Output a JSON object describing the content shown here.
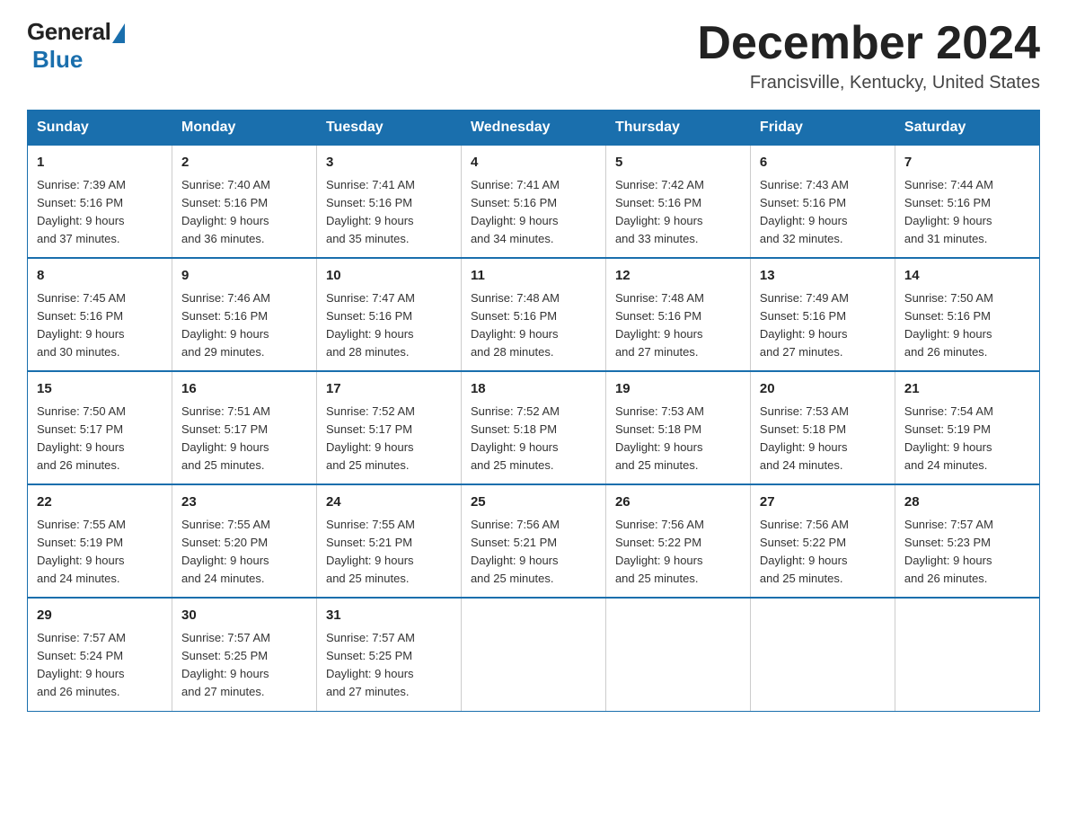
{
  "header": {
    "logo": {
      "general": "General",
      "blue": "Blue"
    },
    "title": "December 2024",
    "location": "Francisville, Kentucky, United States"
  },
  "days_of_week": [
    "Sunday",
    "Monday",
    "Tuesday",
    "Wednesday",
    "Thursday",
    "Friday",
    "Saturday"
  ],
  "weeks": [
    [
      {
        "day": "1",
        "sunrise": "7:39 AM",
        "sunset": "5:16 PM",
        "daylight": "9 hours and 37 minutes."
      },
      {
        "day": "2",
        "sunrise": "7:40 AM",
        "sunset": "5:16 PM",
        "daylight": "9 hours and 36 minutes."
      },
      {
        "day": "3",
        "sunrise": "7:41 AM",
        "sunset": "5:16 PM",
        "daylight": "9 hours and 35 minutes."
      },
      {
        "day": "4",
        "sunrise": "7:41 AM",
        "sunset": "5:16 PM",
        "daylight": "9 hours and 34 minutes."
      },
      {
        "day": "5",
        "sunrise": "7:42 AM",
        "sunset": "5:16 PM",
        "daylight": "9 hours and 33 minutes."
      },
      {
        "day": "6",
        "sunrise": "7:43 AM",
        "sunset": "5:16 PM",
        "daylight": "9 hours and 32 minutes."
      },
      {
        "day": "7",
        "sunrise": "7:44 AM",
        "sunset": "5:16 PM",
        "daylight": "9 hours and 31 minutes."
      }
    ],
    [
      {
        "day": "8",
        "sunrise": "7:45 AM",
        "sunset": "5:16 PM",
        "daylight": "9 hours and 30 minutes."
      },
      {
        "day": "9",
        "sunrise": "7:46 AM",
        "sunset": "5:16 PM",
        "daylight": "9 hours and 29 minutes."
      },
      {
        "day": "10",
        "sunrise": "7:47 AM",
        "sunset": "5:16 PM",
        "daylight": "9 hours and 28 minutes."
      },
      {
        "day": "11",
        "sunrise": "7:48 AM",
        "sunset": "5:16 PM",
        "daylight": "9 hours and 28 minutes."
      },
      {
        "day": "12",
        "sunrise": "7:48 AM",
        "sunset": "5:16 PM",
        "daylight": "9 hours and 27 minutes."
      },
      {
        "day": "13",
        "sunrise": "7:49 AM",
        "sunset": "5:16 PM",
        "daylight": "9 hours and 27 minutes."
      },
      {
        "day": "14",
        "sunrise": "7:50 AM",
        "sunset": "5:16 PM",
        "daylight": "9 hours and 26 minutes."
      }
    ],
    [
      {
        "day": "15",
        "sunrise": "7:50 AM",
        "sunset": "5:17 PM",
        "daylight": "9 hours and 26 minutes."
      },
      {
        "day": "16",
        "sunrise": "7:51 AM",
        "sunset": "5:17 PM",
        "daylight": "9 hours and 25 minutes."
      },
      {
        "day": "17",
        "sunrise": "7:52 AM",
        "sunset": "5:17 PM",
        "daylight": "9 hours and 25 minutes."
      },
      {
        "day": "18",
        "sunrise": "7:52 AM",
        "sunset": "5:18 PM",
        "daylight": "9 hours and 25 minutes."
      },
      {
        "day": "19",
        "sunrise": "7:53 AM",
        "sunset": "5:18 PM",
        "daylight": "9 hours and 25 minutes."
      },
      {
        "day": "20",
        "sunrise": "7:53 AM",
        "sunset": "5:18 PM",
        "daylight": "9 hours and 24 minutes."
      },
      {
        "day": "21",
        "sunrise": "7:54 AM",
        "sunset": "5:19 PM",
        "daylight": "9 hours and 24 minutes."
      }
    ],
    [
      {
        "day": "22",
        "sunrise": "7:55 AM",
        "sunset": "5:19 PM",
        "daylight": "9 hours and 24 minutes."
      },
      {
        "day": "23",
        "sunrise": "7:55 AM",
        "sunset": "5:20 PM",
        "daylight": "9 hours and 24 minutes."
      },
      {
        "day": "24",
        "sunrise": "7:55 AM",
        "sunset": "5:21 PM",
        "daylight": "9 hours and 25 minutes."
      },
      {
        "day": "25",
        "sunrise": "7:56 AM",
        "sunset": "5:21 PM",
        "daylight": "9 hours and 25 minutes."
      },
      {
        "day": "26",
        "sunrise": "7:56 AM",
        "sunset": "5:22 PM",
        "daylight": "9 hours and 25 minutes."
      },
      {
        "day": "27",
        "sunrise": "7:56 AM",
        "sunset": "5:22 PM",
        "daylight": "9 hours and 25 minutes."
      },
      {
        "day": "28",
        "sunrise": "7:57 AM",
        "sunset": "5:23 PM",
        "daylight": "9 hours and 26 minutes."
      }
    ],
    [
      {
        "day": "29",
        "sunrise": "7:57 AM",
        "sunset": "5:24 PM",
        "daylight": "9 hours and 26 minutes."
      },
      {
        "day": "30",
        "sunrise": "7:57 AM",
        "sunset": "5:25 PM",
        "daylight": "9 hours and 27 minutes."
      },
      {
        "day": "31",
        "sunrise": "7:57 AM",
        "sunset": "5:25 PM",
        "daylight": "9 hours and 27 minutes."
      },
      null,
      null,
      null,
      null
    ]
  ]
}
